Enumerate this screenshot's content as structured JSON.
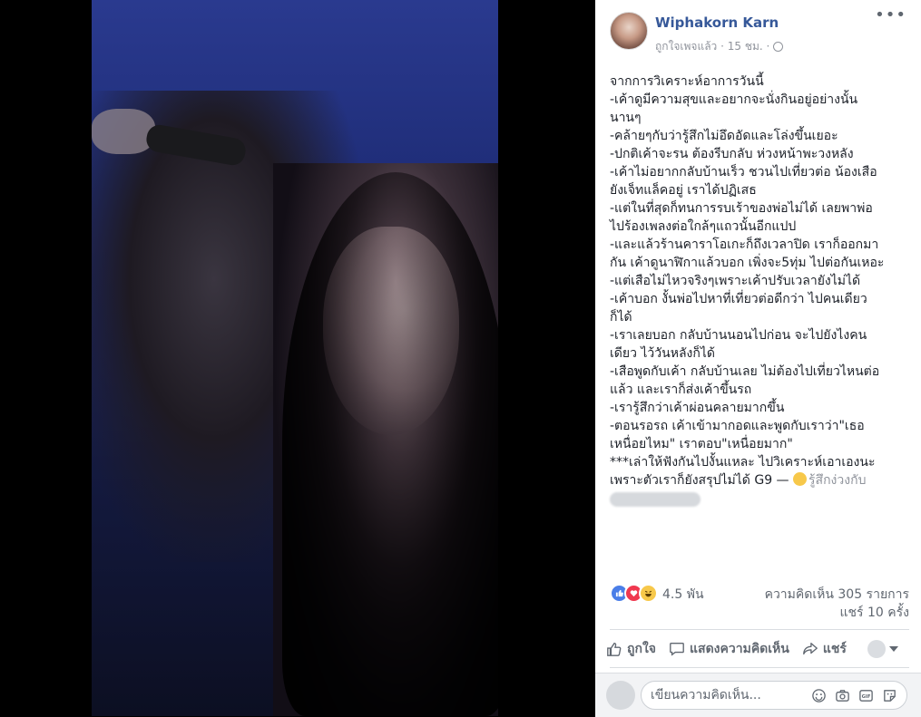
{
  "post": {
    "author": "Wiphakorn Karn",
    "meta_text": "ถูกใจเพจแล้ว · 15 ชม. ·",
    "more_label": "•••",
    "text_lines": [
      "จากการวิเคราะห์อาการวันนี้",
      "-เค้าดูมีความสุขและอยากจะนั่งกินอยู่อย่างนั้น",
      "นานๆ",
      "-คล้ายๆกับว่ารู้สึกไม่อึดอัดและโล่งขึ้นเยอะ",
      "-ปกติเค้าจะรน ต้องรีบกลับ ห่วงหน้าพะวงหลัง",
      "-เค้าไม่อยากกลับบ้านเร็ว ชวนไปเที่ยวต่อ น้องเสือ",
      "ยังเจ็ทแล็คอยู่ เราได้ปฏิเสธ",
      "-แต่ในที่สุดก็ทนการรบเร้าของพ่อไม่ได้ เลยพาพ่อ",
      "ไปร้องเพลงต่อใกล้ๆแถวนั้นอีกแปป",
      "-และแล้วร้านคาราโอเกะก็ถึงเวลาปิด เราก็ออกมา",
      "กัน เค้าดูนาฬิกาแล้วบอก เพิ่งจะ5ทุ่ม ไปต่อกันเหอะ",
      "-แต่เสือไม่ไหวจริงๆเพราะเค้าปรับเวลายังไม่ได้",
      "-เค้าบอก งั้นพ่อไปหาที่เที่ยวต่อดีกว่า ไปคนเดียว",
      "ก็ได้",
      "-เราเลยบอก กลับบ้านนอนไปก่อน จะไปยังไงคน",
      "เดียว ไว้วันหลังก็ได้",
      "-เสือพูดกับเค้า กลับบ้านเลย ไม่ต้องไปเที่ยวไหนต่อ",
      "แล้ว และเราก็ส่งเค้าขึ้นรถ",
      "-เรารู้สึกว่าเค้าผ่อนคลายมากขึ้น",
      "-ตอนรอรถ เค้าเข้ามากอดและพูดกับเราว่า\"เธอ",
      "เหนื่อยไหม\" เราตอบ\"เหนื่อยมาก\"",
      "***เล่าให้ฟังกันไปงั้นแหละ ไปวิเคราะห์เอาเองนะ"
    ],
    "last_line": "เพราะตัวเราก็ยังสรุปไม่ได้ G9 —",
    "feeling": "รู้สึกง่วงกับ"
  },
  "reactions": {
    "count": "4.5 พัน",
    "comments": "ความคิดเห็น 305 รายการ",
    "shares": "แชร์ 10 ครั้ง"
  },
  "actions": {
    "like": "ถูกใจ",
    "comment": "แสดงความคิดเห็น",
    "share": "แชร์"
  },
  "comment_box": {
    "placeholder": "เขียนความคิดเห็น..."
  },
  "colors": {
    "author_link": "#365899",
    "meta_gray": "#90949c",
    "like_blue": "#4a7ee8",
    "love_red": "#f0384f",
    "haha_yellow": "#f7c84a"
  },
  "icons": [
    "like-reaction-icon",
    "love-reaction-icon",
    "haha-reaction-icon",
    "globe-icon",
    "thumb-up-icon",
    "comment-icon",
    "share-icon",
    "emoji-icon",
    "camera-icon",
    "gif-icon",
    "sticker-icon"
  ]
}
